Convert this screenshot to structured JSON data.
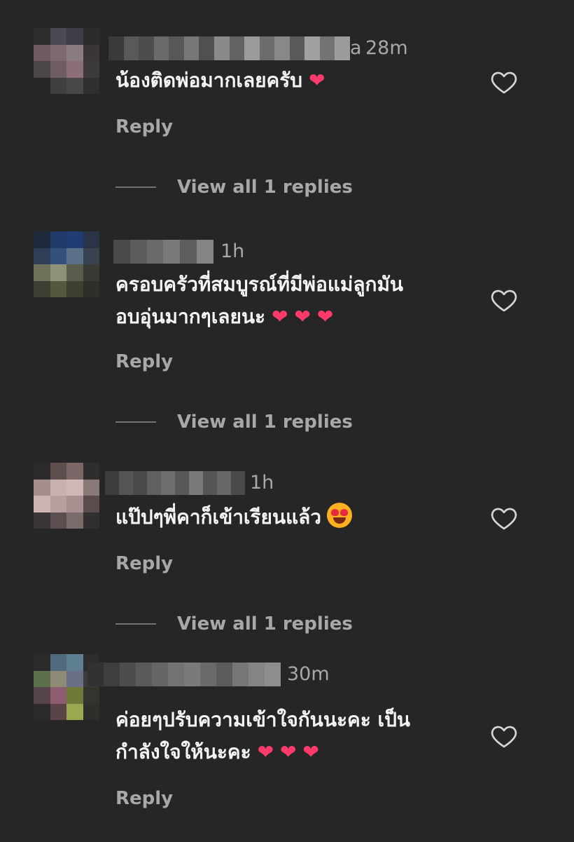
{
  "comments": [
    {
      "timestamp": "28m",
      "username_tail": "a",
      "text_lines": [
        "น้องติดพ่อมากเลยครับ"
      ],
      "emojis": [
        "heart"
      ],
      "reply_label": "Reply",
      "view_replies_label": "View all 1 replies",
      "avatar_colors": [
        "#2f2c2e",
        "#4a4a52",
        "#3e3c44",
        "#2b2b2b",
        "#6e5a60",
        "#7d6a72",
        "#8a7b82",
        "#3a3638",
        "#4b4449",
        "#6d5d63",
        "#8e6e76",
        "#3c3a3c",
        "#262626",
        "#3f3f3f",
        "#4a4747",
        "#2f2f2f"
      ],
      "username_colors": [
        "#3a3a3a",
        "#595959",
        "#4d4d4d",
        "#6a6a6a",
        "#575757",
        "#777777",
        "#505050",
        "#8a8a8a",
        "#626262",
        "#9a9a9a",
        "#6c6c6c",
        "#888888",
        "#5a5a5a",
        "#a0a0a0",
        "#737373",
        "#9c9c9c"
      ]
    },
    {
      "timestamp": "1h",
      "text_lines": [
        "ครอบครัวที่สมบูรณ์ที่มีพ่อแม่ลูกมัน",
        "อบอุ่นมากๆเลยนะ"
      ],
      "emojis": [
        "heart",
        "heart",
        "heart"
      ],
      "reply_label": "Reply",
      "view_replies_label": "View all 1 replies",
      "avatar_colors": [
        "#1e2a3c",
        "#1f3a6b",
        "#213b73",
        "#2a3446",
        "#2f3d56",
        "#34517e",
        "#5a6f88",
        "#3a4250",
        "#6e725a",
        "#8d9278",
        "#585c4a",
        "#3a3a34",
        "#3c3d33",
        "#55573e",
        "#3e3f33",
        "#2e2e2a"
      ],
      "username_colors": [
        "#4a4a4a",
        "#5c5c5c",
        "#6a6a6a",
        "#7a7a7a",
        "#5e5e5e",
        "#848484"
      ]
    },
    {
      "timestamp": "1h",
      "text_lines": [
        "แป๊ปๆพี่คาก็เข้าเรียนแล้ว"
      ],
      "emojis": [
        "star-eyes"
      ],
      "reply_label": "Reply",
      "view_replies_label": "View all 1 replies",
      "avatar_colors": [
        "#2c2b2b",
        "#5e4e4e",
        "#7a6666",
        "#2f2d2d",
        "#a68e8e",
        "#c9b1b0",
        "#d0b8b6",
        "#8a7878",
        "#cdb3b2",
        "#b89e9d",
        "#a99090",
        "#5a4c4c",
        "#3a3536",
        "#5a4e4f",
        "#7b6c6c",
        "#322f30"
      ],
      "username_colors": [
        "#3c3c3c",
        "#555555",
        "#4a4a4a",
        "#606060",
        "#6e6e6e",
        "#585858",
        "#7a7a7a",
        "#555555",
        "#686868",
        "#4a4a4a"
      ]
    },
    {
      "timestamp": "30m",
      "text_lines": [
        "ค่อยๆปรับความเข้าใจกันนะคะ เป็น",
        "กำลังใจให้นะคะ"
      ],
      "emojis": [
        "heart",
        "heart",
        "heart"
      ],
      "reply_label": "Reply",
      "view_replies_label": "",
      "avatar_colors": [
        "#2a2a2a",
        "#4f6b7d",
        "#5f7f92",
        "#2d2d2d",
        "#5d6e4a",
        "#8f8a76",
        "#6a6e86",
        "#3c3c38",
        "#56444c",
        "#8e5c6e",
        "#6f7a3a",
        "#34342c",
        "#2c2b2b",
        "#5b4448",
        "#9aa84e",
        "#2e2e2a"
      ],
      "username_colors": [
        "#323232",
        "#3e3e3e",
        "#4d4d4d",
        "#5a5a5a",
        "#666666",
        "#727272",
        "#7a7a7a",
        "#6a6a6a",
        "#5c5c5c",
        "#767676",
        "#848484",
        "#8e8e8e"
      ]
    }
  ]
}
